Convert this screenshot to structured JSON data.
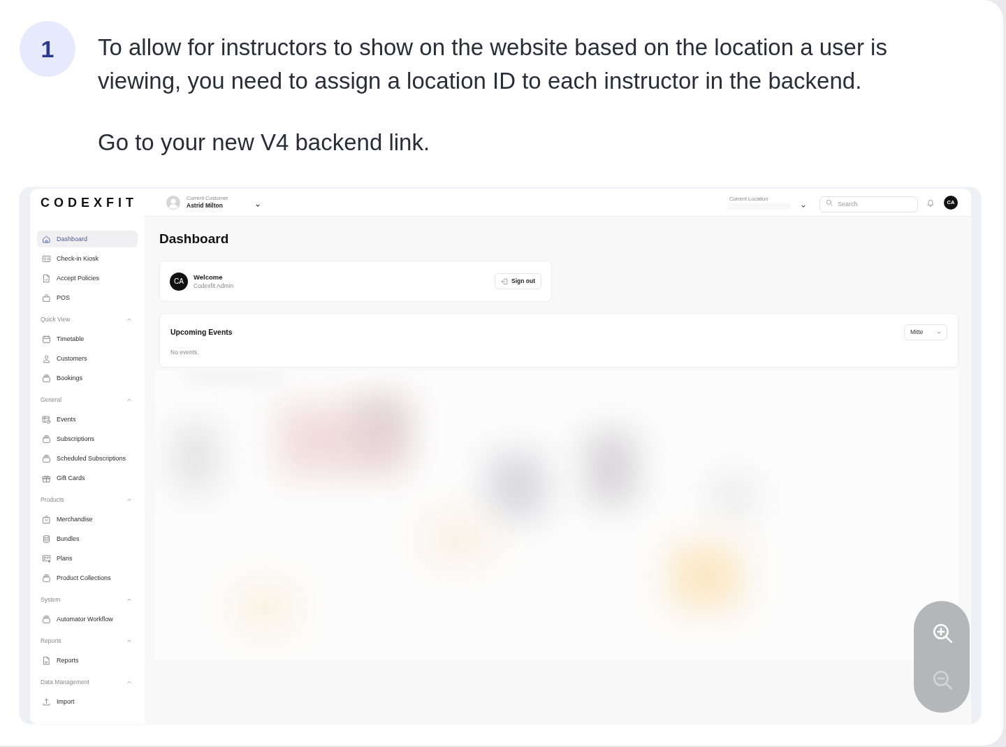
{
  "step": {
    "number": "1",
    "paragraphs": [
      "To allow for instructors to show on the website based on the location a user is viewing, you need to assign a location ID to each instructor in the backend.",
      "Go to your new V4 backend link."
    ]
  },
  "app": {
    "logo": "CODEXFIT",
    "header": {
      "customer": {
        "label": "Current Customer",
        "name": "Astrid Milton"
      },
      "location": {
        "label": "Current Location"
      },
      "search": {
        "placeholder": "Search"
      },
      "avatar": "CA"
    },
    "sidebar": {
      "items": [
        {
          "label": "Dashboard",
          "selected": true
        },
        {
          "label": "Check-in Kiosk",
          "selected": false
        },
        {
          "label": "Accept Policies",
          "selected": false
        },
        {
          "label": "POS",
          "selected": false
        }
      ],
      "sections": [
        {
          "title": "Quick View",
          "expanded": true,
          "items": [
            {
              "label": "Timetable",
              "selected": false
            },
            {
              "label": "Customers",
              "selected": false
            },
            {
              "label": "Bookings",
              "selected": false
            }
          ]
        },
        {
          "title": "General",
          "expanded": true,
          "items": [
            {
              "label": "Events",
              "selected": false
            },
            {
              "label": "Subscriptions",
              "selected": false
            },
            {
              "label": "Scheduled Subscriptions",
              "selected": false
            },
            {
              "label": "Gift Cards",
              "selected": false
            }
          ]
        },
        {
          "title": "Products",
          "expanded": true,
          "items": [
            {
              "label": "Merchandise",
              "selected": false
            },
            {
              "label": "Bundles",
              "selected": false
            },
            {
              "label": "Plans",
              "selected": false
            },
            {
              "label": "Product Collections",
              "selected": false
            }
          ]
        },
        {
          "title": "System",
          "expanded": true,
          "items": [
            {
              "label": "Automator Workflow",
              "selected": false
            }
          ]
        },
        {
          "title": "Reports",
          "expanded": true,
          "items": [
            {
              "label": "Reports",
              "selected": false
            }
          ]
        },
        {
          "title": "Data Management",
          "expanded": true,
          "items": [
            {
              "label": "Import",
              "selected": false
            }
          ]
        }
      ]
    },
    "page_title": "Dashboard",
    "welcome_card": {
      "avatar": "CA",
      "title": "Welcome",
      "subtitle": "Codexfit Admin",
      "button": "Sign out"
    },
    "events_card": {
      "title": "Upcoming Events",
      "empty_text": "No events.",
      "location_select": {
        "value": "Mitte"
      }
    }
  },
  "zoom_controls": [
    {
      "kind": "zoom-in",
      "disabled": false
    },
    {
      "kind": "zoom-out",
      "disabled": true
    }
  ]
}
